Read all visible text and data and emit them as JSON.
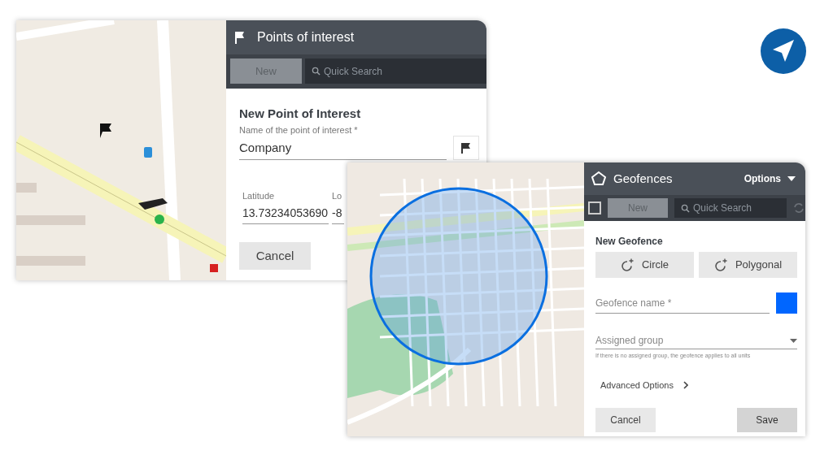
{
  "poi_panel": {
    "title": "Points of interest",
    "new_button": "New",
    "search": {
      "placeholder": "Quick Search"
    },
    "form": {
      "heading": "New Point of Interest",
      "name_field": {
        "label": "Name of the point of interest *",
        "value": "Company"
      },
      "latitude": {
        "label": "Latitude",
        "value": "13.73234053690"
      },
      "longitude": {
        "label": "Lo",
        "value": "-8"
      },
      "cancel": "Cancel"
    }
  },
  "geofence_panel": {
    "title": "Geofences",
    "options": "Options",
    "select_all": {
      "checked": false
    },
    "new_button": "New",
    "search": {
      "placeholder": "Quick Search"
    },
    "form": {
      "heading": "New Geofence",
      "shape_buttons": [
        "Circle",
        "Polygonal"
      ],
      "name_field": {
        "placeholder": "Geofence name *"
      },
      "color": "#0066ff",
      "group_field": {
        "placeholder": "Assigned group"
      },
      "hint": "If there is no assigned group, the geofence applies to all units",
      "advanced": "Advanced Options",
      "cancel": "Cancel",
      "save": "Save"
    }
  }
}
